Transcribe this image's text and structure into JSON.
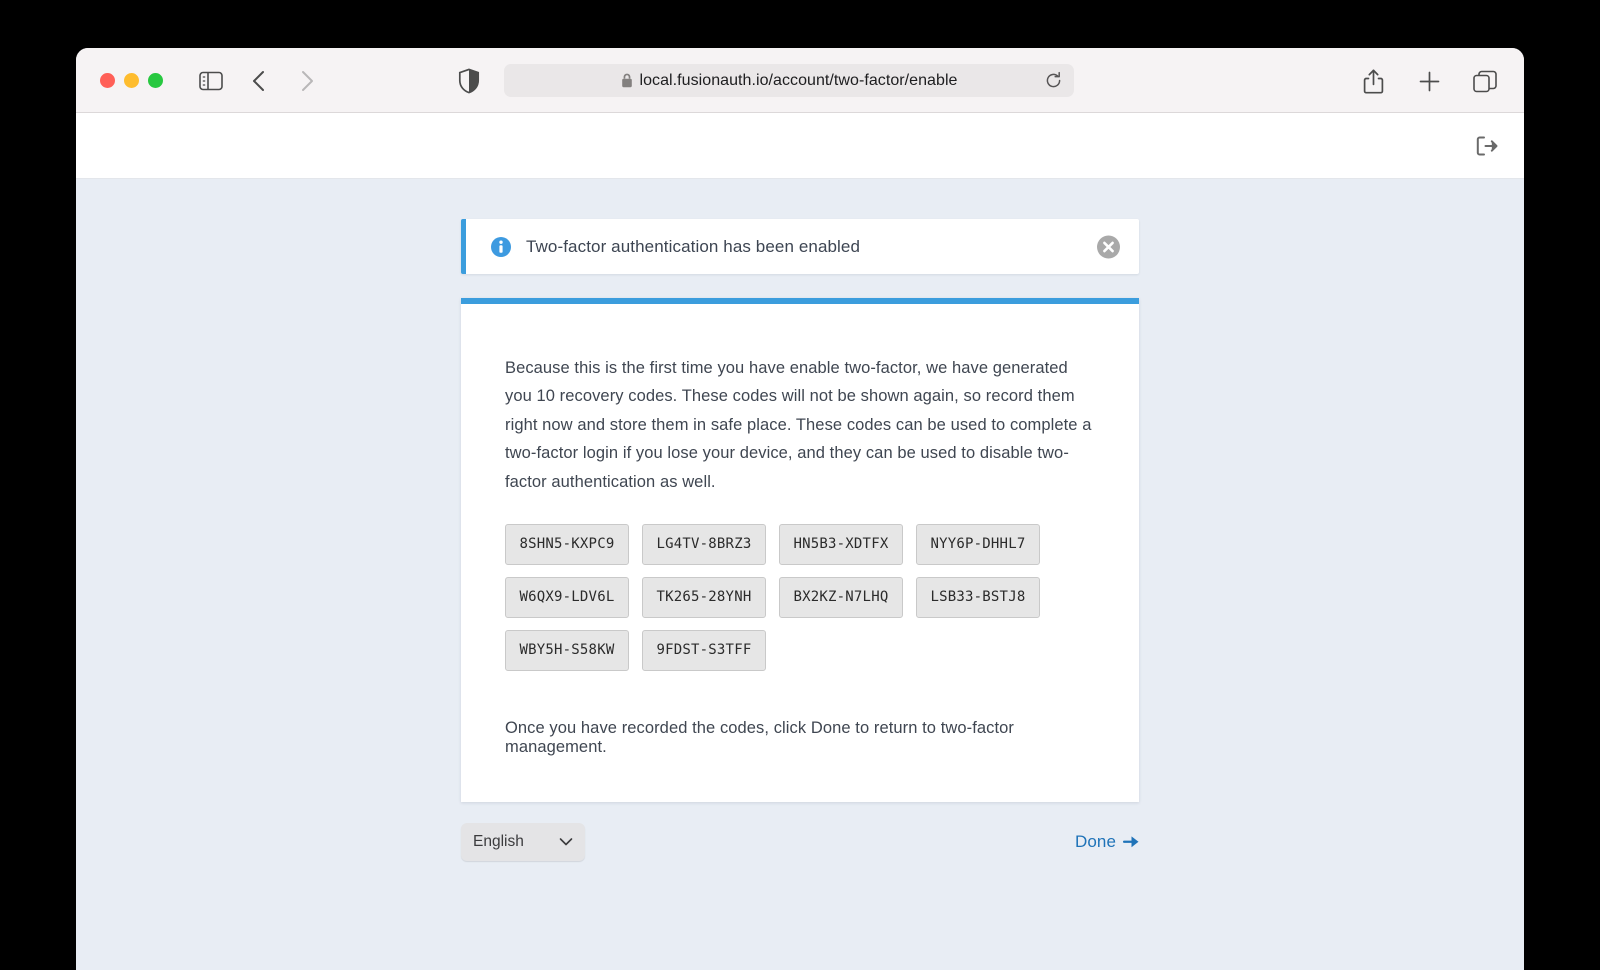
{
  "browser": {
    "traffic_lights": [
      {
        "name": "close",
        "color": "#ff5f57"
      },
      {
        "name": "minimize",
        "color": "#febc2e"
      },
      {
        "name": "maximize",
        "color": "#28c840"
      }
    ],
    "sidebar_toggle_icon": "sidebar-icon",
    "back_icon": "chevron-left-icon",
    "forward_icon": "chevron-right-icon",
    "shield_icon": "privacy-shield-icon",
    "lock_icon": "lock-icon",
    "url": "local.fusionauth.io/account/two-factor/enable",
    "reload_icon": "reload-icon",
    "share_icon": "share-icon",
    "new_tab_icon": "plus-icon",
    "tab_overview_icon": "tab-overview-icon"
  },
  "app_header": {
    "logout_icon": "logout-icon"
  },
  "alert": {
    "icon": "info-circle-icon",
    "message": "Two-factor authentication has been enabled",
    "close_icon": "close-circle-icon",
    "accent_color": "#3b9ddd"
  },
  "card": {
    "accent_color": "#3b9ddd",
    "paragraph": "Because this is the first time you have enable two-factor, we have generated you 10 recovery codes. These codes will not be shown again, so record them right now and store them in safe place. These codes can be used to complete a two-factor login if you lose your device, and they can be used to disable two-factor authentication as well.",
    "recovery_codes": [
      "8SHN5-KXPC9",
      "LG4TV-8BRZ3",
      "HN5B3-XDTFX",
      "NYY6P-DHHL7",
      "W6QX9-LDV6L",
      "TK265-28YNH",
      "BX2KZ-N7LHQ",
      "LSB33-BSTJ8",
      "WBY5H-S58KW",
      "9FDST-S3TFF"
    ],
    "footnote": "Once you have recorded the codes, click Done to return to two-factor management."
  },
  "footer": {
    "language_value": "English",
    "language_chevron_icon": "chevron-down-icon",
    "done_label": "Done",
    "done_arrow_icon": "arrow-right-icon",
    "done_color": "#1f73b8"
  }
}
